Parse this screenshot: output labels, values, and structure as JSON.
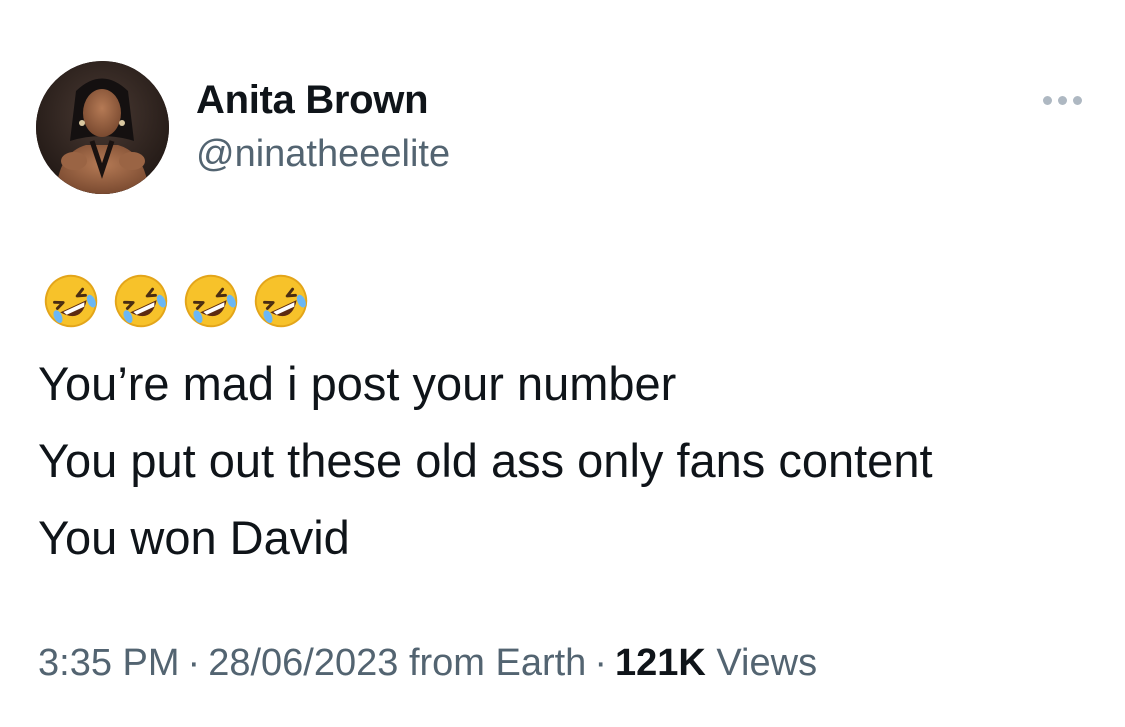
{
  "author": {
    "display_name": "Anita Brown",
    "handle": "@ninatheeelite"
  },
  "tweet": {
    "emoji_icon": "rolling-on-the-floor-laughing-icon",
    "emoji_count": 4,
    "lines": [
      "You’re mad i post your number",
      "You put out these old ass only fans content",
      "You won David"
    ]
  },
  "meta": {
    "time": "3:35 PM",
    "separator": "·",
    "date": "28/06/2023",
    "source": "from Earth",
    "views_count": "121K",
    "views_label": "Views"
  },
  "colors": {
    "text_primary": "#0f1419",
    "text_secondary": "#536471",
    "more_dots": "#aeb8c2"
  }
}
